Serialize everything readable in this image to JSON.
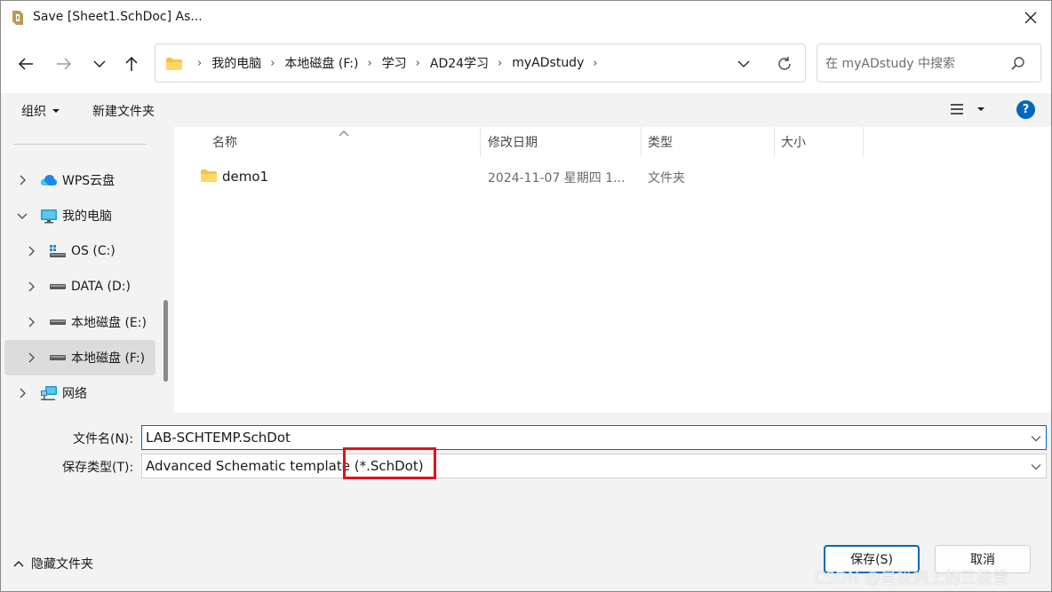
{
  "window": {
    "title": "Save [Sheet1.SchDoc] As..."
  },
  "nav": {
    "breadcrumbs": [
      "我的电脑",
      "本地磁盘 (F:)",
      "学习",
      "AD24学习",
      "myADstudy"
    ],
    "search_placeholder": "在 myADstudy 中搜索"
  },
  "commandbar": {
    "organize": "组织",
    "new_folder": "新建文件夹",
    "help": "?"
  },
  "sidebar": {
    "items": [
      {
        "label": "WPS云盘",
        "icon": "cloud-icon",
        "expanded": false
      },
      {
        "label": "我的电脑",
        "icon": "computer-icon",
        "expanded": true
      },
      {
        "label": "OS (C:)",
        "icon": "windows-drive-icon",
        "expanded": false
      },
      {
        "label": "DATA (D:)",
        "icon": "drive-icon",
        "expanded": false
      },
      {
        "label": "本地磁盘 (E:)",
        "icon": "drive-icon",
        "expanded": false
      },
      {
        "label": "本地磁盘 (F:)",
        "icon": "drive-icon",
        "expanded": false,
        "selected": true
      },
      {
        "label": "网络",
        "icon": "network-icon",
        "expanded": false
      }
    ]
  },
  "filelist": {
    "columns": [
      "名称",
      "修改日期",
      "类型",
      "大小"
    ],
    "rows": [
      {
        "name": "demo1",
        "modified": "2024-11-07 星期四 1...",
        "type": "文件夹",
        "size": ""
      }
    ]
  },
  "form": {
    "filename_label": "文件名(N):",
    "filename_value": "LAB-SCHTEMP.SchDot",
    "filetype_label": "保存类型(T):",
    "filetype_value": "Advanced Schematic template (*.SchDot)"
  },
  "footer": {
    "hide_folders": "隐藏文件夹",
    "save": "保存(S)",
    "cancel": "取消"
  },
  "watermark": "CSDN @星极向上的三极管",
  "colors": {
    "accent": "#0067c0",
    "highlight_box": "#e3101e",
    "folder": "#f5c542"
  }
}
